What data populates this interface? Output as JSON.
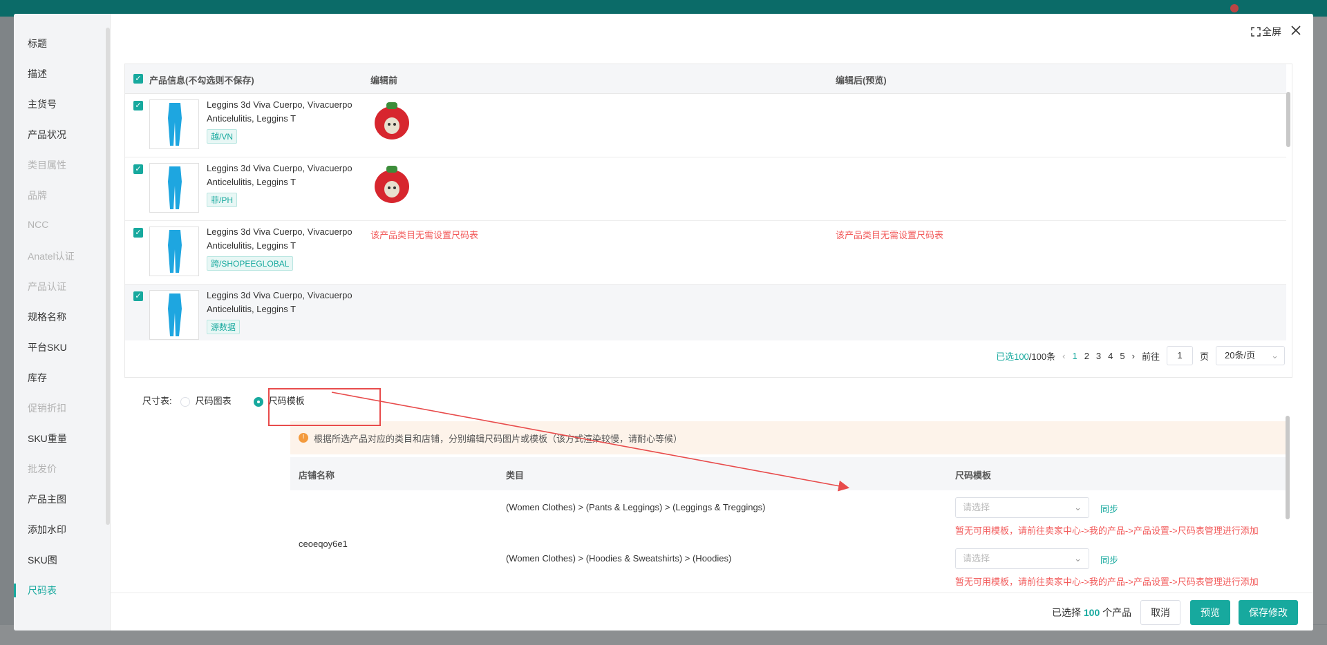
{
  "sidebar": {
    "items": [
      {
        "label": "标题",
        "state": "normal"
      },
      {
        "label": "描述",
        "state": "normal"
      },
      {
        "label": "主货号",
        "state": "normal"
      },
      {
        "label": "产品状况",
        "state": "normal"
      },
      {
        "label": "类目属性",
        "state": "disabled"
      },
      {
        "label": "品牌",
        "state": "disabled"
      },
      {
        "label": "NCC",
        "state": "disabled"
      },
      {
        "label": "Anatel认证",
        "state": "disabled"
      },
      {
        "label": "产品认证",
        "state": "disabled"
      },
      {
        "label": "规格名称",
        "state": "normal"
      },
      {
        "label": "平台SKU",
        "state": "normal"
      },
      {
        "label": "库存",
        "state": "normal"
      },
      {
        "label": "促销折扣",
        "state": "disabled"
      },
      {
        "label": "SKU重量",
        "state": "normal"
      },
      {
        "label": "批发价",
        "state": "disabled"
      },
      {
        "label": "产品主图",
        "state": "normal"
      },
      {
        "label": "添加水印",
        "state": "normal"
      },
      {
        "label": "SKU图",
        "state": "normal"
      },
      {
        "label": "尺码表",
        "state": "active"
      }
    ]
  },
  "header": {
    "fullscreen_label": "全屏",
    "fullscreen_icon": "expand-icon",
    "close_icon": "close-icon"
  },
  "product_table": {
    "columns": [
      "产品信息(不勾选则不保存)",
      "编辑前",
      "编辑后(预览)"
    ],
    "rows": [
      {
        "name": "Leggins 3d Viva Cuerpo, Vivacuerpo Anticelulitis, Leggins T",
        "tag": "越/VN",
        "before": "",
        "after": ""
      },
      {
        "name": "Leggins 3d Viva Cuerpo, Vivacuerpo Anticelulitis, Leggins T",
        "tag": "菲/PH",
        "before": "",
        "after": ""
      },
      {
        "name": "Leggins 3d Viva Cuerpo, Vivacuerpo Anticelulitis, Leggins T",
        "tag": "跨/SHOPEEGLOBAL",
        "before": "该产品类目无需设置尺码表",
        "after": "该产品类目无需设置尺码表"
      },
      {
        "name": "Leggins 3d Viva Cuerpo, Vivacuerpo Anticelulitis, Leggins T",
        "tag": "源数据",
        "before": "",
        "after": ""
      }
    ]
  },
  "pager": {
    "selected_prefix": "已选",
    "selected": "100",
    "total_text": "/100条",
    "pages": [
      "1",
      "2",
      "3",
      "4",
      "5"
    ],
    "goto_label": "前往",
    "goto_value": "1",
    "page_label": "页",
    "page_size": "20条/页"
  },
  "size_chart": {
    "label": "尺寸表:",
    "option_image": "尺码图表",
    "option_template": "尺码模板",
    "notice": "根据所选产品对应的类目和店铺，分别编辑尺码图片或模板（该方式渲染较慢，请耐心等候）",
    "columns": [
      "店铺名称",
      "类目",
      "尺码模板"
    ],
    "shop": "ceoeqoy6e1",
    "entries": [
      {
        "category": "(Women Clothes) > (Pants & Leggings) > (Leggings & Treggings)",
        "placeholder": "请选择",
        "sync": "同步",
        "warning": "暂无可用模板，请前往卖家中心->我的产品->产品设置->尺码表管理进行添加"
      },
      {
        "category": "(Women Clothes) > (Hoodies & Sweatshirts) > (Hoodies)",
        "placeholder": "请选择",
        "sync": "同步",
        "warning": "暂无可用模板，请前往卖家中心->我的产品->产品设置->尺码表管理进行添加"
      }
    ]
  },
  "footer": {
    "selected_prefix": "已选择",
    "selected_count": "100",
    "selected_suffix": "个产品",
    "cancel": "取消",
    "preview": "预览",
    "save": "保存修改"
  },
  "colors": {
    "accent": "#17a99e",
    "warning": "#f25b5b",
    "annotation": "#e84b4b"
  }
}
